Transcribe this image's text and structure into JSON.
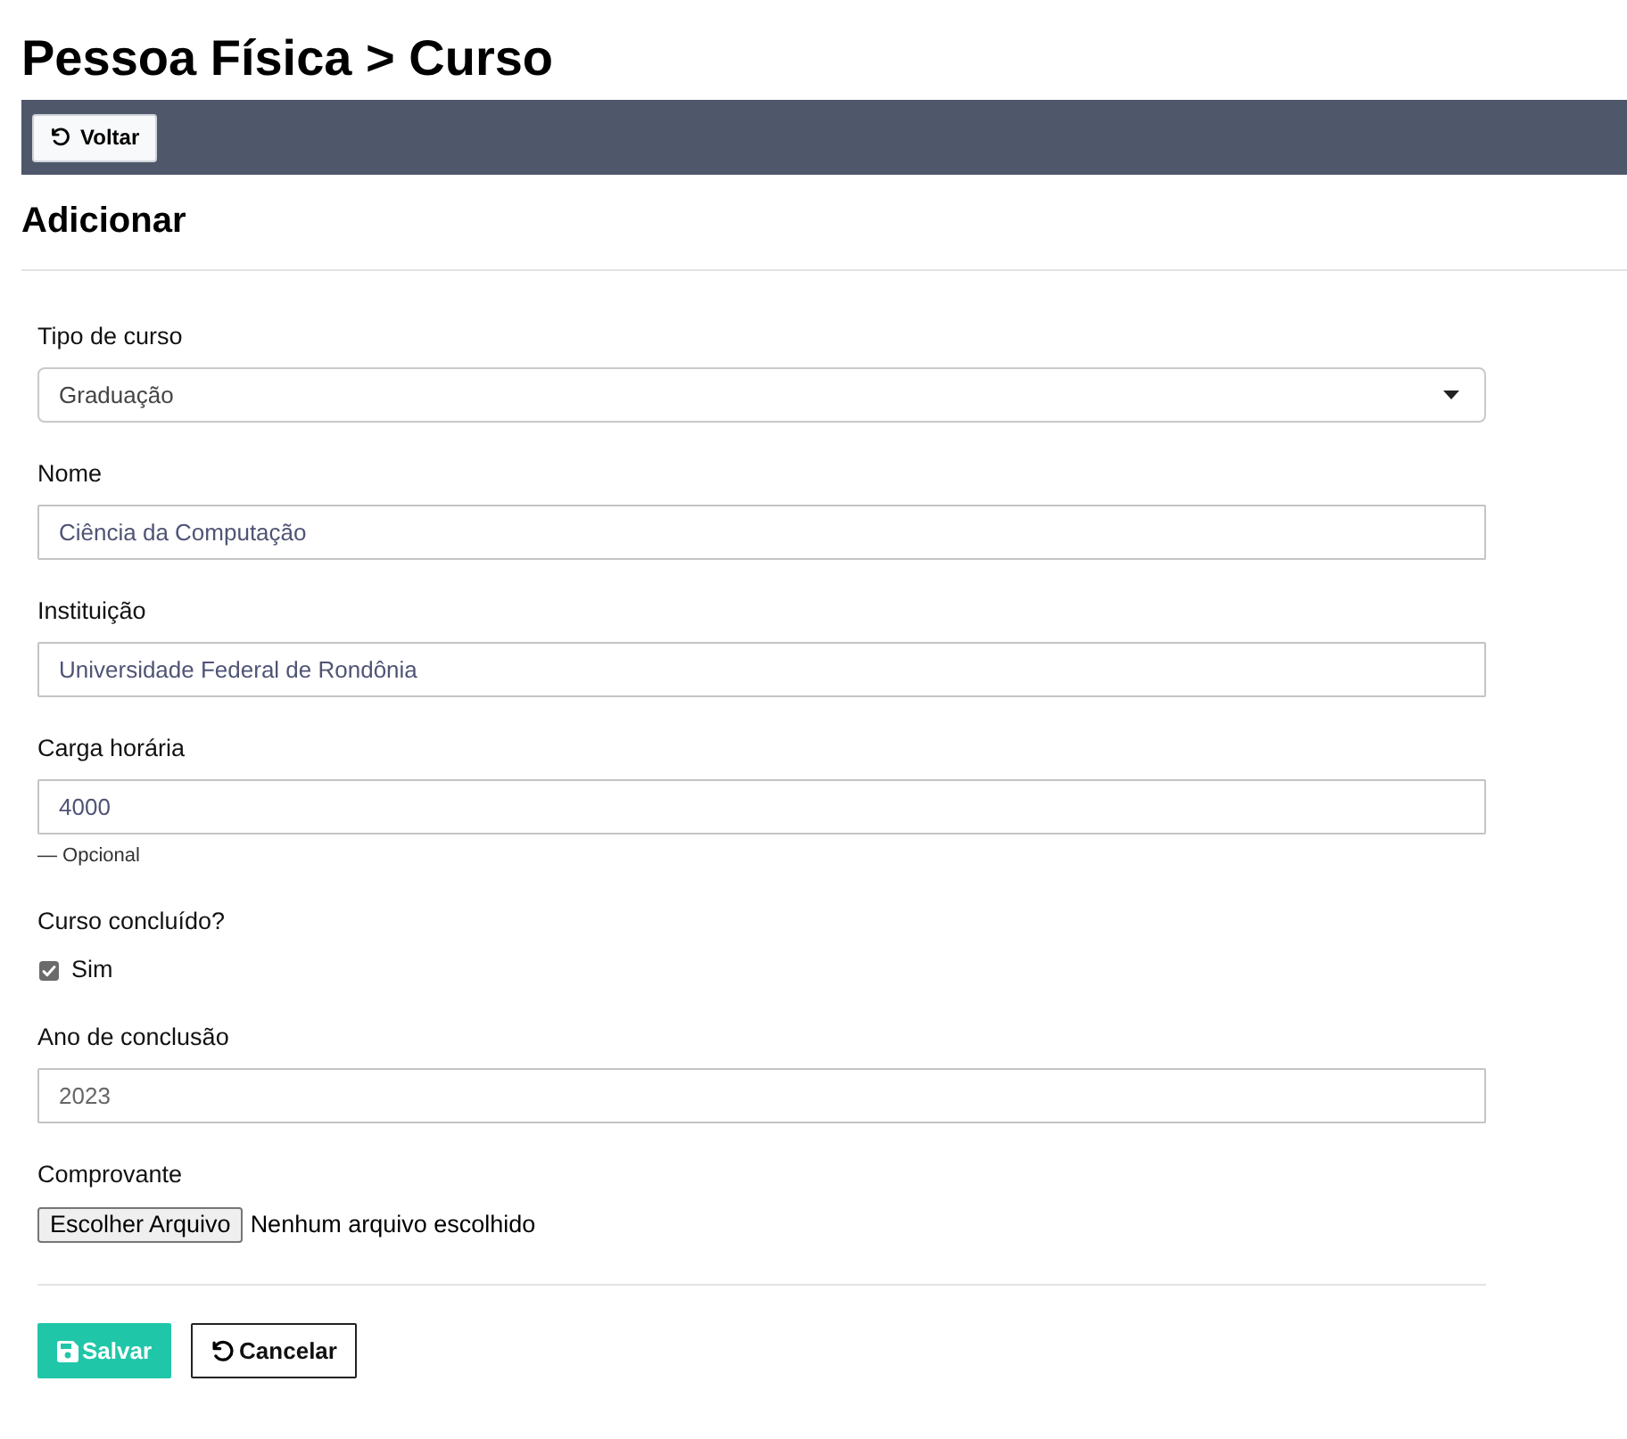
{
  "page": {
    "title": "Pessoa Física > Curso"
  },
  "toolbar": {
    "back_button": "Voltar"
  },
  "section": {
    "title": "Adicionar"
  },
  "fields": [
    {
      "kind": "select",
      "label": "Tipo de curso",
      "value": "Graduação"
    },
    {
      "kind": "text",
      "label": "Nome",
      "value": "Ciência da Computação"
    },
    {
      "kind": "text",
      "label": "Instituição",
      "value": "Universidade Federal de Rondônia"
    },
    {
      "kind": "text",
      "label": "Carga horária",
      "value": "4000",
      "help": "— Opcional"
    },
    {
      "kind": "checkbox",
      "label": "Curso concluído?",
      "option": "Sim",
      "checked": true
    },
    {
      "kind": "number",
      "label": "Ano de conclusão",
      "value": "2023"
    },
    {
      "kind": "file",
      "label": "Comprovante",
      "button": "Escolher Arquivo",
      "status": "Nenhum arquivo escolhido"
    }
  ],
  "actions": [
    {
      "kind": "primary",
      "label": "Salvar"
    },
    {
      "kind": "secondary",
      "label": "Cancelar"
    }
  ]
}
